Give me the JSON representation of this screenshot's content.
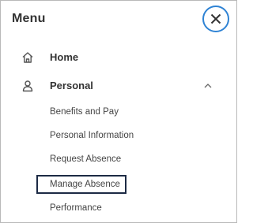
{
  "header": {
    "title": "Menu",
    "close_icon": "close-icon"
  },
  "nav": {
    "items": [
      {
        "label": "Home",
        "icon": "home-icon"
      },
      {
        "label": "Personal",
        "icon": "person-icon",
        "expanded": true
      }
    ],
    "personal_submenu": [
      {
        "label": "Benefits and Pay"
      },
      {
        "label": "Personal Information"
      },
      {
        "label": "Request Absence"
      },
      {
        "label": "Manage Absence",
        "selected": true
      },
      {
        "label": "Performance"
      }
    ]
  },
  "colors": {
    "close_ring": "#2f83d4",
    "selection_border": "#1c2a44",
    "text": "#333333"
  }
}
